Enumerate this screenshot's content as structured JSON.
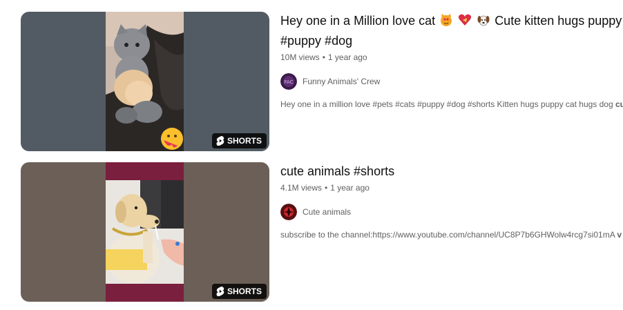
{
  "results": [
    {
      "title_line1": "Hey one in a Million love cat",
      "title_emojis": [
        "cat-heart-eyes-icon",
        "heart-with-ribbon-icon",
        "dog-face-icon"
      ],
      "title_line1_rest": "Cute kitten hugs puppy #",
      "title_line2": "#puppy #dog",
      "views": "10M views",
      "age": "1 year ago",
      "channel": "Funny Animals' Crew",
      "description": "Hey one in a million love #pets #cats #puppy #dog #shorts Kitten hugs puppy cat hugs dog",
      "description_bold": "cu",
      "badge": "SHORTS",
      "colors": {
        "bg": "#505961",
        "frame": "#6f6a63"
      }
    },
    {
      "title_line1": "cute animals #shorts",
      "views": "4.1M views",
      "age": "1 year ago",
      "channel": "Cute animals",
      "description": "subscribe to the channel:https://www.youtube.com/channel/UC8P7b6GHWolw4rcg7si01mA",
      "description_bold": "v",
      "badge": "SHORTS",
      "colors": {
        "bg": "#6b6058",
        "frame": "#7a1f3d"
      }
    }
  ],
  "meta_separator": "•"
}
